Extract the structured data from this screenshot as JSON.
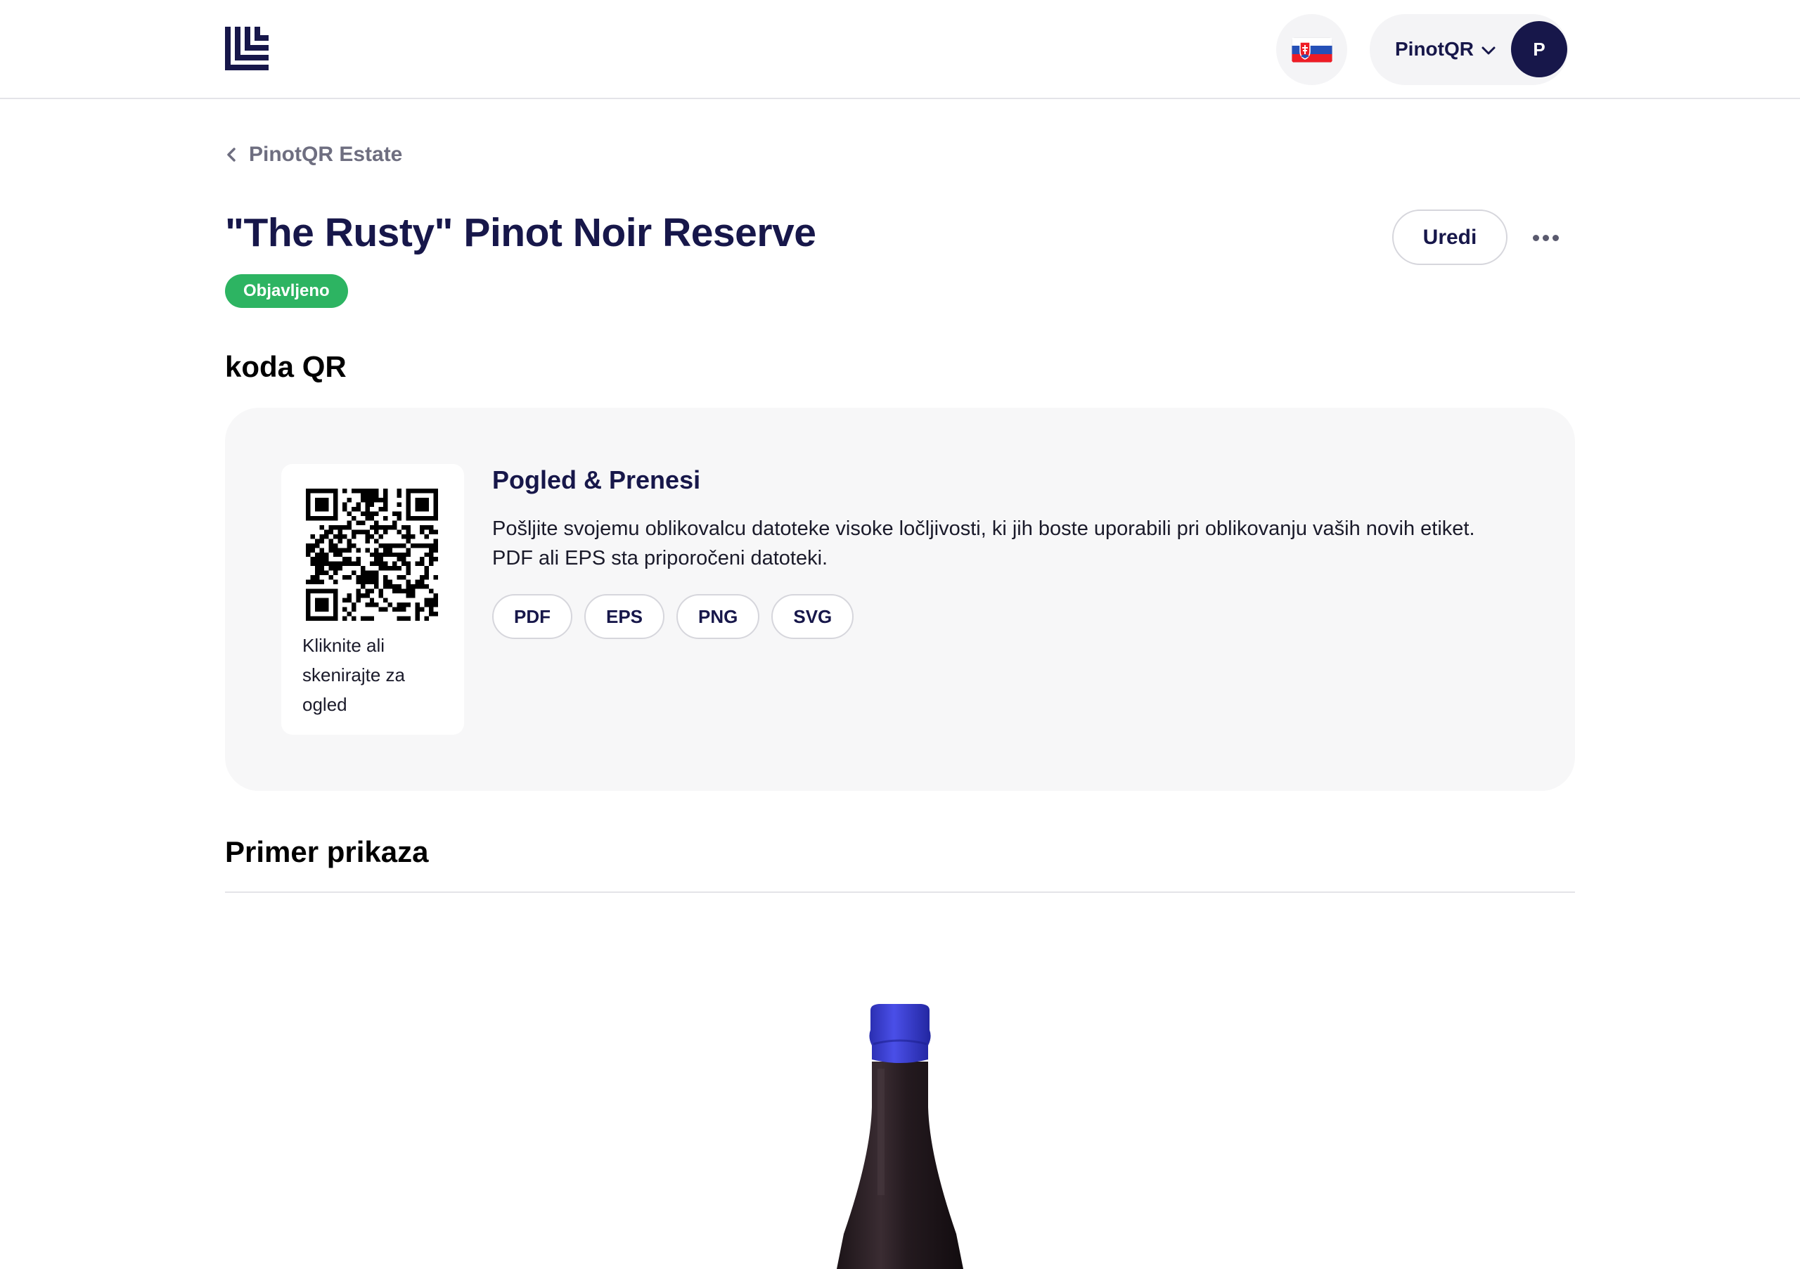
{
  "header": {
    "logo_icon": "brand-logo-icon",
    "language_icon": "slovak-flag-icon",
    "account_name": "PinotQR",
    "avatar_initial": "P"
  },
  "breadcrumb": {
    "label": "PinotQR Estate"
  },
  "page": {
    "title": "\"The Rusty\" Pinot Noir Reserve",
    "status": "Objavljeno",
    "edit_label": "Uredi"
  },
  "qr_section": {
    "title": "koda QR",
    "caption": "Kliknite ali skenirajte za ogled",
    "info_title": "Pogled & Prenesi",
    "info_description": "Pošljite svojemu oblikovalcu datoteke visoke ločljivosti, ki jih boste uporabili pri oblikovanju vaših novih etiket. PDF ali EPS sta priporočeni datoteki.",
    "formats": [
      "PDF",
      "EPS",
      "PNG",
      "SVG"
    ]
  },
  "preview_section": {
    "title": "Primer prikaza"
  },
  "colors": {
    "brand_navy": "#17174a",
    "status_green": "#2db462",
    "capsule_blue": "#3b3fd6"
  }
}
